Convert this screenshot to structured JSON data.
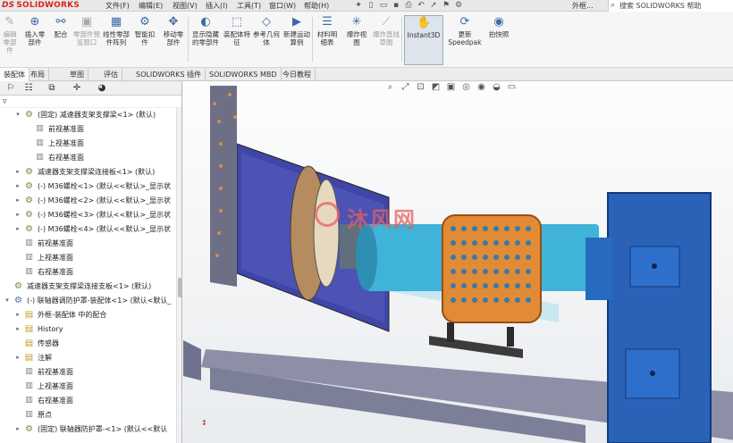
{
  "app": {
    "logo_prefix": "DS",
    "logo": "SOLIDWORKS"
  },
  "menu": [
    "文件(F)",
    "编辑(E)",
    "视图(V)",
    "插入(I)",
    "工具(T)",
    "窗口(W)",
    "帮助(H)"
  ],
  "quick_icons": [
    "pin-icon",
    "new-document-icon",
    "open-icon",
    "save-icon",
    "print-icon",
    "undo-icon",
    "select-icon",
    "rebuild-icon",
    "options-icon"
  ],
  "doc_title": "外框...",
  "help_search": {
    "placeholder": "搜索 SOLIDWORKS 帮助"
  },
  "ribbon": [
    {
      "label": "编辑零部件",
      "icon": "✎",
      "state": "dim"
    },
    {
      "label": "插入零部件",
      "icon": "⊕",
      "state": "normal"
    },
    {
      "label": "配合",
      "icon": "⚯",
      "state": "normal"
    },
    {
      "label": "零部件预览窗口",
      "icon": "▣",
      "state": "dim"
    },
    {
      "label": "线性零部件阵列",
      "icon": "▦",
      "state": "normal"
    },
    {
      "label": "智能扣件",
      "icon": "⚙",
      "state": "normal"
    },
    {
      "label": "移动零部件",
      "icon": "✥",
      "state": "normal"
    },
    {
      "label": "显示隐藏的零部件",
      "icon": "◐",
      "state": "normal"
    },
    {
      "label": "装配体特征",
      "icon": "⬚",
      "state": "normal"
    },
    {
      "label": "参考几何体",
      "icon": "◇",
      "state": "normal"
    },
    {
      "label": "新建运动算例",
      "icon": "▶",
      "state": "normal"
    },
    {
      "label": "材料明细表",
      "icon": "☰",
      "state": "normal"
    },
    {
      "label": "爆炸视图",
      "icon": "✳",
      "state": "normal"
    },
    {
      "label": "爆炸直线草图",
      "icon": "⟋",
      "state": "dim"
    },
    {
      "label": "Instant3D",
      "icon": "✋",
      "state": "sel"
    },
    {
      "label": "更新 Speedpak",
      "icon": "⟳",
      "state": "normal"
    },
    {
      "label": "拍快照",
      "icon": "◉",
      "state": "normal"
    }
  ],
  "tabs": [
    "装配体",
    "布局",
    "草图",
    "评估",
    "SOLIDWORKS 插件",
    "SOLIDWORKS MBD",
    "今日教程"
  ],
  "panel_tabs": [
    "feature-manager-icon",
    "property-manager-icon",
    "configuration-manager-icon",
    "dimxpert-icon",
    "display-manager-icon"
  ],
  "tree": [
    {
      "label": "(固定) 减速器支架支撑梁<1> (默认)",
      "level": 1,
      "icon": "part",
      "expand": "▾"
    },
    {
      "label": "前视基准面",
      "level": 2,
      "icon": "plane",
      "expand": ""
    },
    {
      "label": "上视基准面",
      "level": 2,
      "icon": "plane",
      "expand": ""
    },
    {
      "label": "右视基准面",
      "level": 2,
      "icon": "plane",
      "expand": ""
    },
    {
      "label": "减速器支架支撑梁连接板<1> (默认)",
      "level": 1,
      "icon": "part",
      "expand": "▸"
    },
    {
      "label": "(-) M36螺栓<1> (默认<<默认>_显示状",
      "level": 1,
      "icon": "part",
      "expand": "▸"
    },
    {
      "label": "(-) M36螺栓<2> (默认<<默认>_显示状",
      "level": 1,
      "icon": "part",
      "expand": "▸"
    },
    {
      "label": "(-) M36螺栓<3> (默认<<默认>_显示状",
      "level": 1,
      "icon": "part",
      "expand": "▸"
    },
    {
      "label": "(-) M36螺栓<4> (默认<<默认>_显示状",
      "level": 1,
      "icon": "part",
      "expand": "▸"
    },
    {
      "label": "前视基准面",
      "level": 1,
      "icon": "plane",
      "expand": ""
    },
    {
      "label": "上视基准面",
      "level": 1,
      "icon": "plane",
      "expand": ""
    },
    {
      "label": "右视基准面",
      "level": 1,
      "icon": "plane",
      "expand": ""
    },
    {
      "label": "减速器支架支撑梁连接支板<1> (默认)",
      "level": 0,
      "icon": "part",
      "expand": ""
    },
    {
      "label": "(-) 联轴器调防护罩-装配体<1> (默认<默认_",
      "level": 0,
      "icon": "asm",
      "expand": "▾"
    },
    {
      "label": "外框-装配体 中的配合",
      "level": 1,
      "icon": "folder",
      "expand": "▸"
    },
    {
      "label": "History",
      "level": 1,
      "icon": "folder",
      "expand": "▸"
    },
    {
      "label": "传感器",
      "level": 1,
      "icon": "folder",
      "expand": ""
    },
    {
      "label": "注解",
      "level": 1,
      "icon": "folder",
      "expand": "▸"
    },
    {
      "label": "前视基准面",
      "level": 1,
      "icon": "plane",
      "expand": ""
    },
    {
      "label": "上视基准面",
      "level": 1,
      "icon": "plane",
      "expand": ""
    },
    {
      "label": "右视基准面",
      "level": 1,
      "icon": "plane",
      "expand": ""
    },
    {
      "label": "原点",
      "level": 1,
      "icon": "plane",
      "expand": ""
    },
    {
      "label": "(固定) 联轴器防护罩-<1> (默认<<默认",
      "level": 1,
      "icon": "part",
      "expand": "▸"
    }
  ],
  "viewport_icons": [
    "view-orientation-icon",
    "zoom-to-fit-icon",
    "zoom-area-icon",
    "section-view-icon",
    "display-style-icon",
    "hide-show-icon",
    "appearance-icon",
    "scene-icon",
    "monitor-icon"
  ],
  "watermark": "沐风网"
}
